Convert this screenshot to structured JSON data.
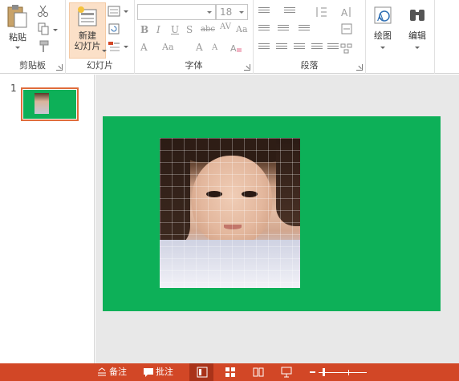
{
  "ribbon": {
    "clipboard": {
      "paste_label": "粘贴",
      "group_label": "剪贴板"
    },
    "slides": {
      "new_slide_line1": "新建",
      "new_slide_line2": "幻灯片",
      "group_label": "幻灯片"
    },
    "font": {
      "font_name": "",
      "font_size": "18",
      "group_label": "字体"
    },
    "paragraph": {
      "group_label": "段落"
    },
    "drawing": {
      "label": "绘图"
    },
    "editing": {
      "label": "编辑"
    }
  },
  "thumbnails": [
    {
      "number": "1"
    }
  ],
  "statusbar": {
    "notes_label": "备注",
    "comments_label": "批注"
  },
  "colors": {
    "accent": "#d24726",
    "slide_bg": "#0db058",
    "thumb_border": "#e06c3b"
  }
}
